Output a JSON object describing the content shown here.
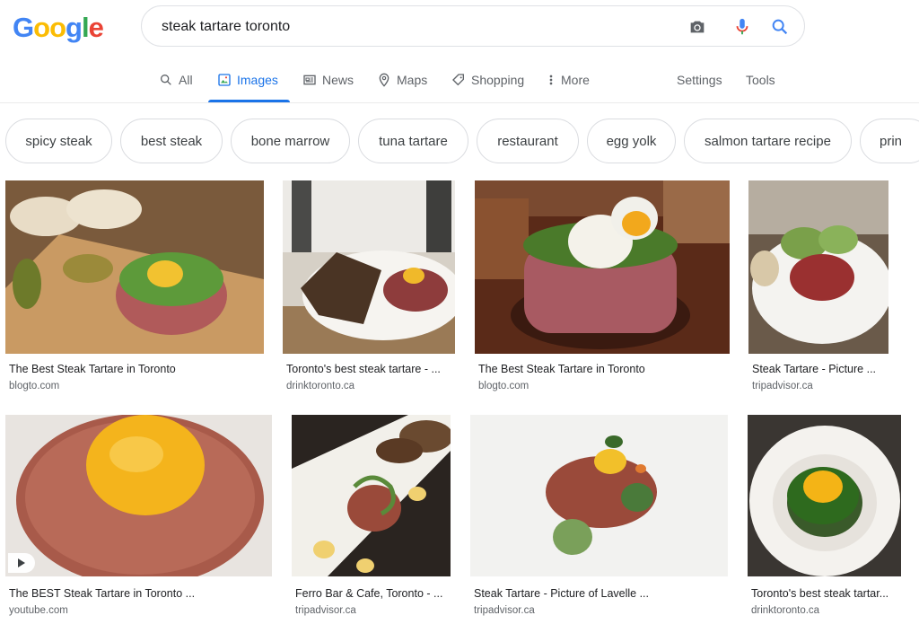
{
  "logo": {
    "letters": [
      "G",
      "o",
      "o",
      "g",
      "l",
      "e"
    ]
  },
  "search": {
    "query": "steak tartare toronto"
  },
  "nav": {
    "tabs": [
      {
        "label": "All",
        "icon": "search-icon"
      },
      {
        "label": "Images",
        "icon": "image-icon",
        "active": true
      },
      {
        "label": "News",
        "icon": "news-icon"
      },
      {
        "label": "Maps",
        "icon": "map-pin-icon"
      },
      {
        "label": "Shopping",
        "icon": "tag-icon"
      },
      {
        "label": "More",
        "icon": "more-vert-icon"
      }
    ],
    "settings": "Settings",
    "tools": "Tools"
  },
  "chips": [
    "spicy steak",
    "best steak",
    "bone marrow",
    "tuna tartare",
    "restaurant",
    "egg yolk",
    "salmon tartare recipe",
    "prin"
  ],
  "results": [
    {
      "title": "The Best Steak Tartare in Toronto",
      "source": "blogto.com"
    },
    {
      "title": "Toronto's best steak tartare - ...",
      "source": "drinktoronto.ca"
    },
    {
      "title": "The Best Steak Tartare in Toronto",
      "source": "blogto.com"
    },
    {
      "title": "Steak Tartare - Picture ...",
      "source": "tripadvisor.ca"
    },
    {
      "title": "The BEST Steak Tartare in Toronto ...",
      "source": "youtube.com"
    },
    {
      "title": "Ferro Bar & Cafe, Toronto - ...",
      "source": "tripadvisor.ca"
    },
    {
      "title": "Steak Tartare - Picture of Lavelle ...",
      "source": "tripadvisor.ca"
    },
    {
      "title": "Toronto's best steak tartar...",
      "source": "drinktoronto.ca"
    }
  ],
  "colors": {
    "accent": "#1a73e8",
    "mic_red": "#ea4335"
  }
}
